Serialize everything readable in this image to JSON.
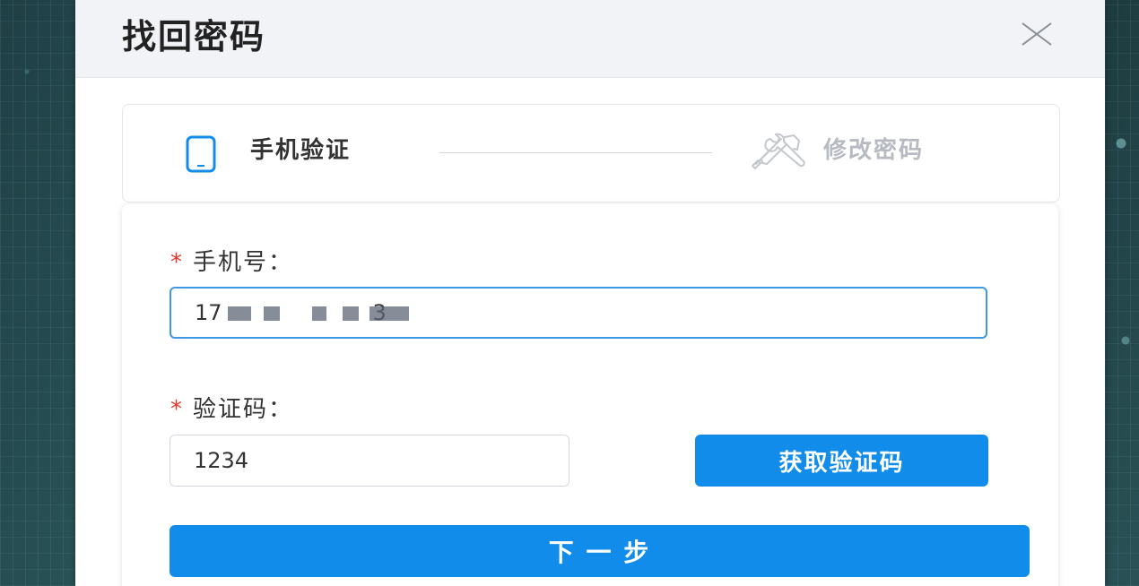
{
  "dialog": {
    "title": "找回密码"
  },
  "steps": {
    "step1_label": "手机验证",
    "step2_label": "修改密码",
    "step1_icon": "mobile-phone-icon",
    "step2_icon": "tools-icon",
    "active_color": "#118cea",
    "inactive_color": "#b7bbc1"
  },
  "form": {
    "required_mark": "*",
    "phone_label": "手机号：",
    "phone_value": "17       3",
    "code_label": "验证码：",
    "code_value": "1234",
    "get_code_button": "获取验证码",
    "next_button": "下 一 步"
  },
  "colors": {
    "accent": "#118cea",
    "required": "#e2372d",
    "focus_border": "#3f98e3"
  }
}
